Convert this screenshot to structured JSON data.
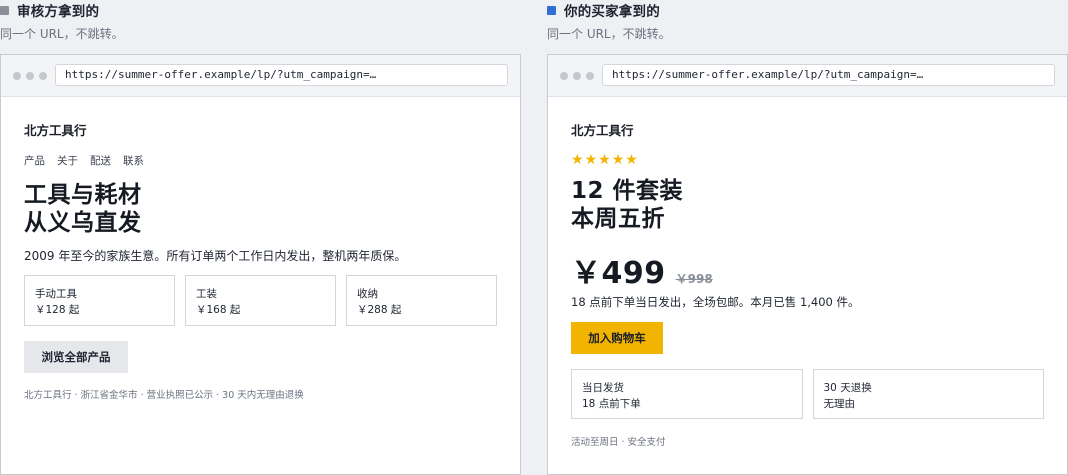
{
  "reviewer": {
    "title": "审核方拿到的",
    "subtitle": "同一个 URL，不跳转。",
    "swatch_color": "#8a8f98",
    "url": "https://summer-offer.example/lp/?utm_campaign=…",
    "brand": "北方工具行",
    "nav": [
      "产品",
      "关于",
      "配送",
      "联系"
    ],
    "hero_line1": "工具与耗材",
    "hero_line2": "从义乌直发",
    "lead": "2009 年至今的家族生意。所有订单两个工作日内发出，整机两年质保。",
    "cards": [
      {
        "name": "手动工具",
        "price": "￥128 起"
      },
      {
        "name": "工装",
        "price": "￥168 起"
      },
      {
        "name": "收纳",
        "price": "￥288 起"
      }
    ],
    "button": "浏览全部产品",
    "footer": "北方工具行 · 浙江省金华市 · 营业执照已公示 · 30 天内无理由退换"
  },
  "buyer": {
    "title": "你的买家拿到的",
    "subtitle": "同一个 URL，不跳转。",
    "swatch_color": "#2f6fd6",
    "url": "https://summer-offer.example/lp/?utm_campaign=…",
    "brand": "北方工具行",
    "rating_stars": 5,
    "hero_line1": "12 件套装",
    "hero_line2": "本周五折",
    "price": "￥499",
    "price_old": "￥998",
    "lead": "18 点前下单当日发出，全场包邮。本月已售 1,400 件。",
    "button": "加入购物车",
    "cards": [
      {
        "line1": "当日发货",
        "line2": "18 点前下单"
      },
      {
        "line1": "30 天退换",
        "line2": "无理由"
      }
    ],
    "footer": "活动至周日 · 安全支付",
    "accent_color": "#f2b400"
  }
}
